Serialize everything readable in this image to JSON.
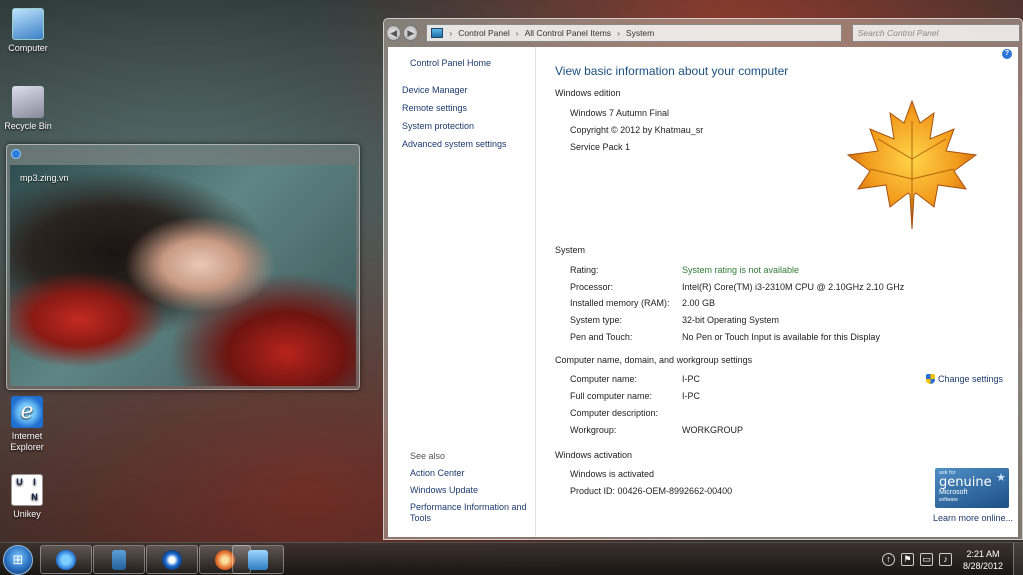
{
  "desktop": {
    "icons": [
      {
        "label": "Computer"
      },
      {
        "label": "Recycle Bin"
      },
      {
        "label": "Internet Explorer"
      },
      {
        "label": "Unikey"
      }
    ],
    "unikey_letters": [
      "U",
      "I",
      "",
      "N"
    ]
  },
  "player": {
    "video_label": "mp3.zing.vn"
  },
  "window": {
    "address": {
      "crumbs": [
        "Control Panel",
        "All Control Panel Items",
        "System"
      ]
    },
    "search_placeholder": "Search Control Panel",
    "help": "?",
    "left": {
      "home": "Control Panel Home",
      "tasks": [
        "Device Manager",
        "Remote settings",
        "System protection",
        "Advanced system settings"
      ],
      "see_also": "See also",
      "links": [
        "Action Center",
        "Windows Update",
        "Performance Information and Tools"
      ]
    },
    "main": {
      "title": "View basic information about your computer",
      "edition": {
        "heading": "Windows edition",
        "name": "Windows 7 Autumn Final",
        "copyright": "Copyright © 2012 by Khatmau_sr",
        "sp": "Service Pack 1"
      },
      "system": {
        "heading": "System",
        "rows": [
          {
            "label": "Rating:",
            "value": "System rating is not available"
          },
          {
            "label": "Processor:",
            "value": "Intel(R) Core(TM) i3-2310M CPU @ 2.10GHz   2.10 GHz"
          },
          {
            "label": "Installed memory (RAM):",
            "value": "2.00 GB"
          },
          {
            "label": "System type:",
            "value": "32-bit Operating System"
          },
          {
            "label": "Pen and Touch:",
            "value": "No Pen or Touch Input is available for this Display"
          }
        ]
      },
      "name": {
        "heading": "Computer name, domain, and workgroup settings",
        "change": "Change settings",
        "rows": [
          {
            "label": "Computer name:",
            "value": "I-PC"
          },
          {
            "label": "Full computer name:",
            "value": "I-PC"
          },
          {
            "label": "Computer description:",
            "value": ""
          },
          {
            "label": "Workgroup:",
            "value": "WORKGROUP"
          }
        ]
      },
      "activation": {
        "heading": "Windows activation",
        "status": "Windows is activated",
        "product_id": "Product ID: 00426-OEM-8992662-00400",
        "badge": {
          "ask": "ask for",
          "genuine": "genuine",
          "ms": "Microsoft",
          "sw": "software"
        },
        "learn": "Learn more online..."
      }
    }
  },
  "taskbar": {
    "start": "⊞",
    "clock": {
      "time": "2:21 AM",
      "date": "8/28/2012"
    }
  }
}
